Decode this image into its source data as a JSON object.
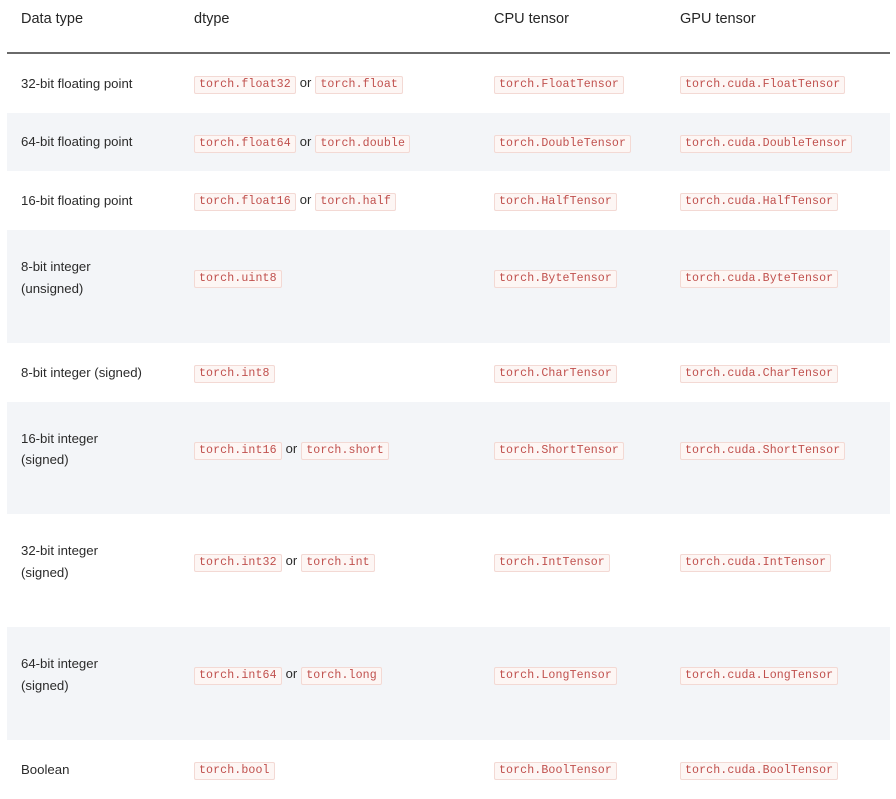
{
  "table": {
    "columns": [
      {
        "key": "datatype",
        "label": "Data type"
      },
      {
        "key": "dtype",
        "label": "dtype"
      },
      {
        "key": "cpu",
        "label": "CPU tensor"
      },
      {
        "key": "gpu",
        "label": "GPU tensor"
      }
    ],
    "or_separator": "or",
    "rows": [
      {
        "datatype": "32-bit floating point",
        "dtype_primary": "torch.float32",
        "dtype_alias": "torch.float",
        "cpu": "torch.FloatTensor",
        "gpu": "torch.cuda.FloatTensor",
        "stripe": false,
        "tall": false
      },
      {
        "datatype": "64-bit floating point",
        "dtype_primary": "torch.float64",
        "dtype_alias": "torch.double",
        "cpu": "torch.DoubleTensor",
        "gpu": "torch.cuda.DoubleTensor",
        "stripe": true,
        "tall": false
      },
      {
        "datatype": "16-bit floating point",
        "dtype_primary": "torch.float16",
        "dtype_alias": "torch.half",
        "cpu": "torch.HalfTensor",
        "gpu": "torch.cuda.HalfTensor",
        "stripe": false,
        "tall": false
      },
      {
        "datatype": "8-bit integer\n(unsigned)",
        "dtype_primary": "torch.uint8",
        "dtype_alias": "",
        "cpu": "torch.ByteTensor",
        "gpu": "torch.cuda.ByteTensor",
        "stripe": true,
        "tall": true
      },
      {
        "datatype": "8-bit integer (signed)",
        "dtype_primary": "torch.int8",
        "dtype_alias": "",
        "cpu": "torch.CharTensor",
        "gpu": "torch.cuda.CharTensor",
        "stripe": false,
        "tall": false
      },
      {
        "datatype": "16-bit integer\n(signed)",
        "dtype_primary": "torch.int16",
        "dtype_alias": "torch.short",
        "cpu": "torch.ShortTensor",
        "gpu": "torch.cuda.ShortTensor",
        "stripe": true,
        "tall": true
      },
      {
        "datatype": "32-bit integer\n(signed)",
        "dtype_primary": "torch.int32",
        "dtype_alias": "torch.int",
        "cpu": "torch.IntTensor",
        "gpu": "torch.cuda.IntTensor",
        "stripe": false,
        "tall": true
      },
      {
        "datatype": "64-bit integer\n(signed)",
        "dtype_primary": "torch.int64",
        "dtype_alias": "torch.long",
        "cpu": "torch.LongTensor",
        "gpu": "torch.cuda.LongTensor",
        "stripe": true,
        "tall": true
      },
      {
        "datatype": "Boolean",
        "dtype_primary": "torch.bool",
        "dtype_alias": "",
        "cpu": "torch.BoolTensor",
        "gpu": "torch.cuda.BoolTensor",
        "stripe": false,
        "tall": false
      }
    ]
  },
  "colors": {
    "code_text": "#c0504d",
    "code_bg": "#fdf6f4",
    "code_border": "#f3d9d4",
    "stripe_bg": "#f3f5f8",
    "header_rule": "#6a6a6a",
    "body_text": "#2b2b2b"
  }
}
